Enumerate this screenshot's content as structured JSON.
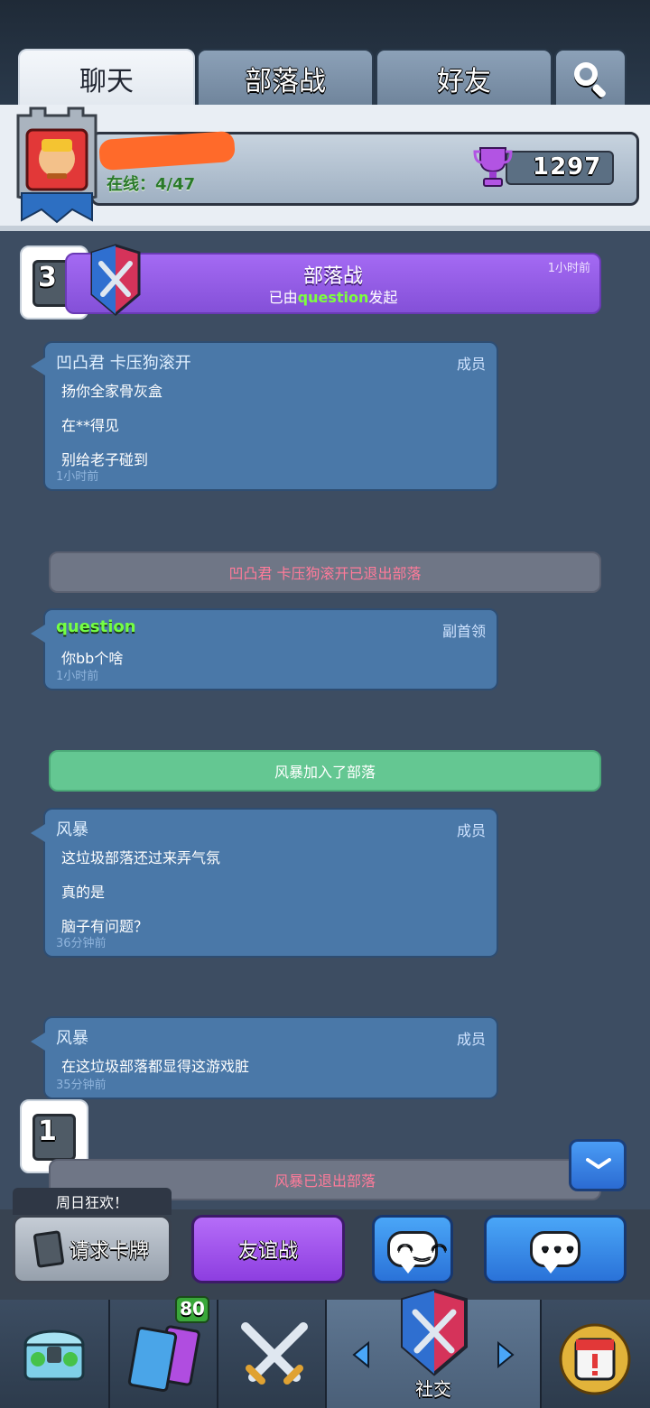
{
  "tabs": [
    {
      "label": "聊天"
    },
    {
      "label": "部落战"
    },
    {
      "label": "好友"
    }
  ],
  "clan": {
    "online": "在线：4/47",
    "trophies": "1297"
  },
  "war_banner": {
    "title": "部落战",
    "subtitle_prefix": "已由",
    "subtitle_user": "question",
    "subtitle_suffix": "发起",
    "time": "1小时前",
    "count": "3"
  },
  "messages": [
    {
      "name": "凹凸君 卡压狗滚开",
      "role": "成员",
      "lines": [
        "扬你全家骨灰盒",
        "在**得见",
        "别给老子碰到"
      ],
      "time": "1小时前"
    },
    {
      "name": "question",
      "role": "副首领",
      "lines": [
        "你bb个啥"
      ],
      "time": "1小时前"
    },
    {
      "name": "风暴",
      "role": "成员",
      "lines": [
        "这垃圾部落还过来弄气氛",
        "真的是",
        "脑子有问题？"
      ],
      "time": "36分钟前"
    },
    {
      "name": "风暴",
      "role": "成员",
      "lines": [
        "在这垃圾部落都显得这游戏脏"
      ],
      "time": "35分钟前"
    }
  ],
  "system": {
    "left1": "凹凸君 卡压狗滚开已退出部落",
    "joined": "风暴加入了部落",
    "left2": "风暴已退出部落"
  },
  "request_count": "1",
  "notice": "周日狂欢！",
  "actions": {
    "request": "请求卡牌",
    "friendly": "友谊战"
  },
  "nav": {
    "cards_count": "80",
    "social": "社交"
  },
  "colors": {
    "bubble": "#4a78a8",
    "war_purple": "#9a60ec",
    "join_green": "#64c792",
    "leave_pink": "#ff7b9a"
  }
}
